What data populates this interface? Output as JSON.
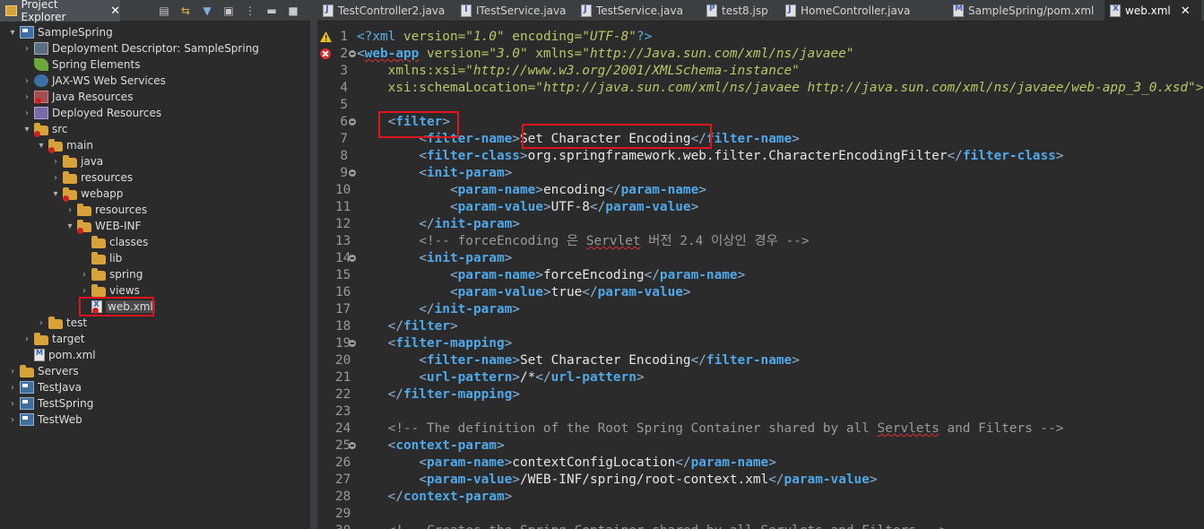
{
  "explorer": {
    "title": "Project Explorer",
    "close_glyph": "✕",
    "toolbar_icons": [
      "collapse-all-icon",
      "link-with-editor-icon",
      "filter-icon",
      "focus-icon",
      "view-menu-icon",
      "minimize-icon",
      "maximize-icon"
    ],
    "tree": [
      {
        "label": "SampleSpring",
        "depth": 0,
        "twisty": "▾",
        "icon": "project"
      },
      {
        "label": "Deployment Descriptor: SampleSpring",
        "depth": 1,
        "twisty": "›",
        "icon": "box"
      },
      {
        "label": "Spring Elements",
        "depth": 1,
        "twisty": "",
        "icon": "leaf"
      },
      {
        "label": "JAX-WS Web Services",
        "depth": 1,
        "twisty": "›",
        "icon": "ws"
      },
      {
        "label": "Java Resources",
        "depth": 1,
        "twisty": "›",
        "icon": "jar",
        "error": true
      },
      {
        "label": "Deployed Resources",
        "depth": 1,
        "twisty": "›",
        "icon": "res"
      },
      {
        "label": "src",
        "depth": 1,
        "twisty": "▾",
        "icon": "folder",
        "error": true
      },
      {
        "label": "main",
        "depth": 2,
        "twisty": "▾",
        "icon": "folder",
        "error": true
      },
      {
        "label": "java",
        "depth": 3,
        "twisty": "›",
        "icon": "folder"
      },
      {
        "label": "resources",
        "depth": 3,
        "twisty": "›",
        "icon": "folder"
      },
      {
        "label": "webapp",
        "depth": 3,
        "twisty": "▾",
        "icon": "folder",
        "error": true
      },
      {
        "label": "resources",
        "depth": 4,
        "twisty": "›",
        "icon": "folder"
      },
      {
        "label": "WEB-INF",
        "depth": 4,
        "twisty": "▾",
        "icon": "folder",
        "error": true
      },
      {
        "label": "classes",
        "depth": 5,
        "twisty": "",
        "icon": "folder"
      },
      {
        "label": "lib",
        "depth": 5,
        "twisty": "",
        "icon": "folder"
      },
      {
        "label": "spring",
        "depth": 5,
        "twisty": "›",
        "icon": "folder"
      },
      {
        "label": "views",
        "depth": 5,
        "twisty": "›",
        "icon": "folder"
      },
      {
        "label": "web.xml",
        "depth": 5,
        "twisty": "",
        "icon": "xml",
        "error": true,
        "highlighted": true
      },
      {
        "label": "test",
        "depth": 2,
        "twisty": "›",
        "icon": "folder"
      },
      {
        "label": "target",
        "depth": 1,
        "twisty": "›",
        "icon": "folder"
      },
      {
        "label": "pom.xml",
        "depth": 1,
        "twisty": "",
        "icon": "pom"
      },
      {
        "label": "Servers",
        "depth": 0,
        "twisty": "›",
        "icon": "folder"
      },
      {
        "label": "TestJava",
        "depth": 0,
        "twisty": "›",
        "icon": "project"
      },
      {
        "label": "TestSpring",
        "depth": 0,
        "twisty": "›",
        "icon": "project"
      },
      {
        "label": "TestWeb",
        "depth": 0,
        "twisty": "›",
        "icon": "project"
      }
    ]
  },
  "editor": {
    "tabs": [
      {
        "label": "TestController2.java",
        "icon": "java",
        "active": false
      },
      {
        "label": "ITestService.java",
        "icon": "iface",
        "active": false
      },
      {
        "label": "TestService.java",
        "icon": "java",
        "active": false
      },
      {
        "label": "test8.jsp",
        "icon": "jsp",
        "active": false
      },
      {
        "label": "HomeController.java",
        "icon": "java",
        "active": false
      },
      {
        "label": "SampleSpring/pom.xml",
        "icon": "pom",
        "active": false
      },
      {
        "label": "web.xml",
        "icon": "xml",
        "active": true
      }
    ],
    "close_glyph": "✕",
    "lines": [
      {
        "n": "1",
        "marker": "warning",
        "fold": false,
        "segs": [
          [
            "pi",
            "<?xml "
          ],
          [
            "attr",
            "version="
          ],
          [
            "val",
            "\"1.0\""
          ],
          [
            "attr",
            " encoding="
          ],
          [
            "val",
            "\"UTF-8\""
          ],
          [
            "pi",
            "?>"
          ]
        ]
      },
      {
        "n": "2",
        "marker": "error",
        "fold": true,
        "segs": [
          [
            "br",
            "<"
          ],
          [
            "tagsq",
            "web-app"
          ],
          [
            "attr",
            " version="
          ],
          [
            "val",
            "\"3.0\""
          ],
          [
            "attr",
            " xmlns="
          ],
          [
            "val",
            "\"http://Java.sun.com/xml/ns/javaee\""
          ]
        ]
      },
      {
        "n": "3",
        "marker": "",
        "fold": false,
        "segs": [
          [
            "text",
            "    "
          ],
          [
            "attr",
            "xmlns:xsi="
          ],
          [
            "val",
            "\"http://www.w3.org/2001/XMLSchema-instance\""
          ]
        ]
      },
      {
        "n": "4",
        "marker": "",
        "fold": false,
        "segs": [
          [
            "text",
            "    "
          ],
          [
            "attr",
            "xsi:schemaLocation="
          ],
          [
            "val",
            "\"http://java.sun.com/xml/ns/javaee http://java.sun.com/xml/ns/javaee/web-app_3_0.xsd\">"
          ]
        ]
      },
      {
        "n": "5",
        "marker": "",
        "fold": false,
        "segs": []
      },
      {
        "n": "6",
        "marker": "",
        "fold": true,
        "segs": [
          [
            "text",
            "    "
          ],
          [
            "br",
            "<"
          ],
          [
            "tag",
            "filter"
          ],
          [
            "br",
            ">"
          ]
        ]
      },
      {
        "n": "7",
        "marker": "",
        "fold": false,
        "segs": [
          [
            "text",
            "        "
          ],
          [
            "br",
            "<"
          ],
          [
            "tag",
            "filter-name"
          ],
          [
            "br",
            ">"
          ],
          [
            "text",
            "Set Character Encoding"
          ],
          [
            "br",
            "</"
          ],
          [
            "tag",
            "filter-name"
          ],
          [
            "br",
            ">"
          ]
        ]
      },
      {
        "n": "8",
        "marker": "",
        "fold": false,
        "segs": [
          [
            "text",
            "        "
          ],
          [
            "br",
            "<"
          ],
          [
            "tag",
            "filter-class"
          ],
          [
            "br",
            ">"
          ],
          [
            "text",
            "org.springframework.web.filter.CharacterEncodingFilter"
          ],
          [
            "br",
            "</"
          ],
          [
            "tag",
            "filter-class"
          ],
          [
            "br",
            ">"
          ]
        ]
      },
      {
        "n": "9",
        "marker": "",
        "fold": true,
        "segs": [
          [
            "text",
            "        "
          ],
          [
            "br",
            "<"
          ],
          [
            "tag",
            "init-param"
          ],
          [
            "br",
            ">"
          ]
        ]
      },
      {
        "n": "10",
        "marker": "",
        "fold": false,
        "segs": [
          [
            "text",
            "            "
          ],
          [
            "br",
            "<"
          ],
          [
            "tag",
            "param-name"
          ],
          [
            "br",
            ">"
          ],
          [
            "text",
            "encoding"
          ],
          [
            "br",
            "</"
          ],
          [
            "tag",
            "param-name"
          ],
          [
            "br",
            ">"
          ]
        ]
      },
      {
        "n": "11",
        "marker": "",
        "fold": false,
        "segs": [
          [
            "text",
            "            "
          ],
          [
            "br",
            "<"
          ],
          [
            "tag",
            "param-value"
          ],
          [
            "br",
            ">"
          ],
          [
            "text",
            "UTF-8"
          ],
          [
            "br",
            "</"
          ],
          [
            "tag",
            "param-value"
          ],
          [
            "br",
            ">"
          ]
        ]
      },
      {
        "n": "12",
        "marker": "",
        "fold": false,
        "segs": [
          [
            "text",
            "        "
          ],
          [
            "br",
            "</"
          ],
          [
            "tag",
            "init-param"
          ],
          [
            "br",
            ">"
          ]
        ]
      },
      {
        "n": "13",
        "marker": "",
        "fold": false,
        "segs": [
          [
            "text",
            "        "
          ],
          [
            "com",
            "<!-- forceEncoding 은 "
          ],
          [
            "comsq",
            "Servlet"
          ],
          [
            "com",
            " 버전 2.4 이상인 경우 -->"
          ]
        ]
      },
      {
        "n": "14",
        "marker": "",
        "fold": true,
        "segs": [
          [
            "text",
            "        "
          ],
          [
            "br",
            "<"
          ],
          [
            "tag",
            "init-param"
          ],
          [
            "br",
            ">"
          ]
        ]
      },
      {
        "n": "15",
        "marker": "",
        "fold": false,
        "segs": [
          [
            "text",
            "            "
          ],
          [
            "br",
            "<"
          ],
          [
            "tag",
            "param-name"
          ],
          [
            "br",
            ">"
          ],
          [
            "text",
            "forceEncoding"
          ],
          [
            "br",
            "</"
          ],
          [
            "tag",
            "param-name"
          ],
          [
            "br",
            ">"
          ]
        ]
      },
      {
        "n": "16",
        "marker": "",
        "fold": false,
        "segs": [
          [
            "text",
            "            "
          ],
          [
            "br",
            "<"
          ],
          [
            "tag",
            "param-value"
          ],
          [
            "br",
            ">"
          ],
          [
            "text",
            "true"
          ],
          [
            "br",
            "</"
          ],
          [
            "tag",
            "param-value"
          ],
          [
            "br",
            ">"
          ]
        ]
      },
      {
        "n": "17",
        "marker": "",
        "fold": false,
        "segs": [
          [
            "text",
            "        "
          ],
          [
            "br",
            "</"
          ],
          [
            "tag",
            "init-param"
          ],
          [
            "br",
            ">"
          ]
        ]
      },
      {
        "n": "18",
        "marker": "",
        "fold": false,
        "segs": [
          [
            "text",
            "    "
          ],
          [
            "br",
            "</"
          ],
          [
            "tag",
            "filter"
          ],
          [
            "br",
            ">"
          ]
        ]
      },
      {
        "n": "19",
        "marker": "",
        "fold": true,
        "segs": [
          [
            "text",
            "    "
          ],
          [
            "br",
            "<"
          ],
          [
            "tag",
            "filter-mapping"
          ],
          [
            "br",
            ">"
          ]
        ]
      },
      {
        "n": "20",
        "marker": "",
        "fold": false,
        "segs": [
          [
            "text",
            "        "
          ],
          [
            "br",
            "<"
          ],
          [
            "tag",
            "filter-name"
          ],
          [
            "br",
            ">"
          ],
          [
            "text",
            "Set Character Encoding"
          ],
          [
            "br",
            "</"
          ],
          [
            "tag",
            "filter-name"
          ],
          [
            "br",
            ">"
          ]
        ]
      },
      {
        "n": "21",
        "marker": "",
        "fold": false,
        "segs": [
          [
            "text",
            "        "
          ],
          [
            "br",
            "<"
          ],
          [
            "tag",
            "url-pattern"
          ],
          [
            "br",
            ">"
          ],
          [
            "text",
            "/*"
          ],
          [
            "br",
            "</"
          ],
          [
            "tag",
            "url-pattern"
          ],
          [
            "br",
            ">"
          ]
        ]
      },
      {
        "n": "22",
        "marker": "",
        "fold": false,
        "segs": [
          [
            "text",
            "    "
          ],
          [
            "br",
            "</"
          ],
          [
            "tag",
            "filter-mapping"
          ],
          [
            "br",
            ">"
          ]
        ]
      },
      {
        "n": "23",
        "marker": "",
        "fold": false,
        "segs": []
      },
      {
        "n": "24",
        "marker": "",
        "fold": false,
        "segs": [
          [
            "text",
            "    "
          ],
          [
            "com",
            "<!-- The definition of the Root Spring Container shared by all "
          ],
          [
            "comsq",
            "Servlets"
          ],
          [
            "com",
            " and Filters -->"
          ]
        ]
      },
      {
        "n": "25",
        "marker": "",
        "fold": true,
        "segs": [
          [
            "text",
            "    "
          ],
          [
            "br",
            "<"
          ],
          [
            "tag",
            "context-param"
          ],
          [
            "br",
            ">"
          ]
        ]
      },
      {
        "n": "26",
        "marker": "",
        "fold": false,
        "segs": [
          [
            "text",
            "        "
          ],
          [
            "br",
            "<"
          ],
          [
            "tag",
            "param-name"
          ],
          [
            "br",
            ">"
          ],
          [
            "text",
            "contextConfigLocation"
          ],
          [
            "br",
            "</"
          ],
          [
            "tag",
            "param-name"
          ],
          [
            "br",
            ">"
          ]
        ]
      },
      {
        "n": "27",
        "marker": "",
        "fold": false,
        "segs": [
          [
            "text",
            "        "
          ],
          [
            "br",
            "<"
          ],
          [
            "tag",
            "param-value"
          ],
          [
            "br",
            ">"
          ],
          [
            "text",
            "/WEB-INF/spring/root-context.xml"
          ],
          [
            "br",
            "</"
          ],
          [
            "tag",
            "param-value"
          ],
          [
            "br",
            ">"
          ]
        ]
      },
      {
        "n": "28",
        "marker": "",
        "fold": false,
        "segs": [
          [
            "text",
            "    "
          ],
          [
            "br",
            "</"
          ],
          [
            "tag",
            "context-param"
          ],
          [
            "br",
            ">"
          ]
        ]
      },
      {
        "n": "29",
        "marker": "",
        "fold": false,
        "segs": []
      },
      {
        "n": "30",
        "marker": "",
        "fold": false,
        "segs": [
          [
            "text",
            "    "
          ],
          [
            "com",
            "<!-- Creates the Spring Container shared by all Servlets and Filters -->"
          ]
        ]
      }
    ]
  },
  "colors": {
    "highlight_box": "#e0141e",
    "error": "#e02a2a",
    "warning": "#e8c020"
  }
}
